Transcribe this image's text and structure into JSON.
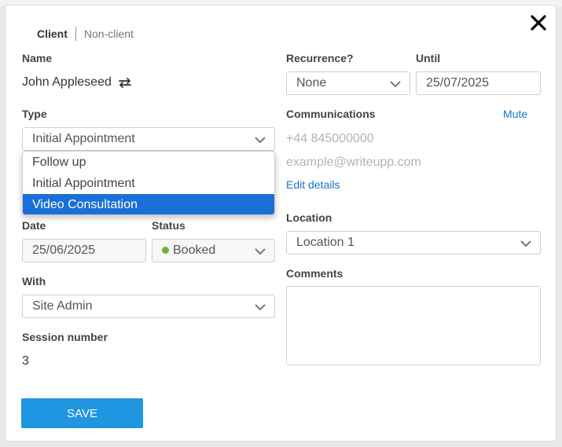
{
  "tabs": {
    "client": "Client",
    "non_client": "Non-client"
  },
  "name": {
    "label": "Name",
    "value": "John Appleseed"
  },
  "recurrence": {
    "label": "Recurrence?",
    "value": "None"
  },
  "until": {
    "label": "Until",
    "value": "25/07/2025"
  },
  "type": {
    "label": "Type",
    "value": "Initial Appointment",
    "options": [
      "Follow up",
      "Initial Appointment",
      "Video Consultation"
    ],
    "highlighted": "Video Consultation"
  },
  "communications": {
    "label": "Communications",
    "mute_label": "Mute",
    "phone": "+44 845000000",
    "email": "example@writeupp.com",
    "edit_label": "Edit details"
  },
  "location": {
    "label": "Location",
    "value": "Location 1"
  },
  "date": {
    "label": "Date",
    "value": "25/06/2025"
  },
  "status": {
    "label": "Status",
    "value": "Booked",
    "color": "#6cb33e"
  },
  "with": {
    "label": "With",
    "value": "Site Admin"
  },
  "comments": {
    "label": "Comments",
    "value": ""
  },
  "session": {
    "label": "Session number",
    "value": "3"
  },
  "save_label": "SAVE",
  "colors": {
    "accent": "#2196e0",
    "link": "#1a73c8",
    "highlight": "#1a6fd6"
  },
  "icons": {
    "close": "close-icon",
    "repeat": "repeat-icon",
    "chevron": "chevron-down-icon"
  }
}
